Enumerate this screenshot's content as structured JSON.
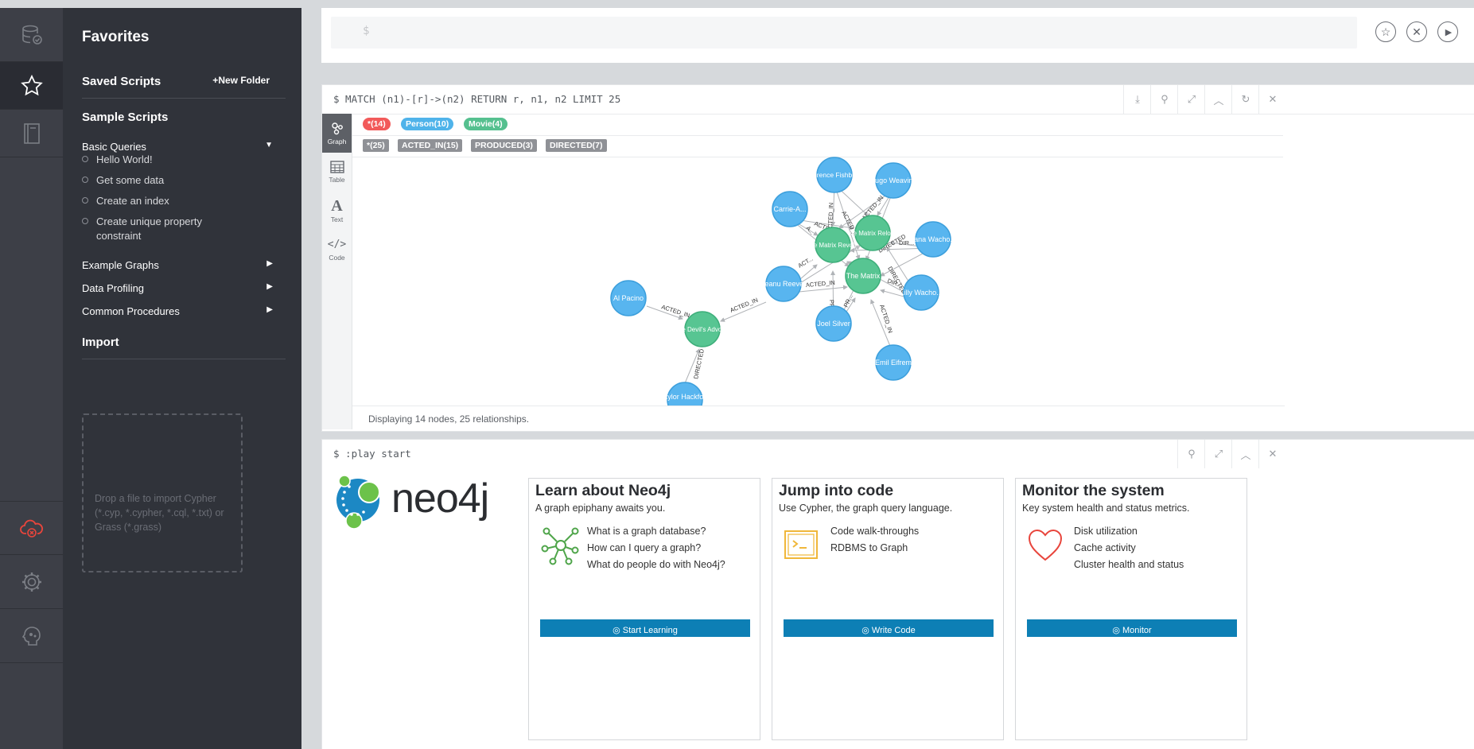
{
  "editor": {
    "prompt": "$"
  },
  "drawer": {
    "title": "Favorites",
    "saved_scripts": "Saved Scripts",
    "new_folder": "New Folder",
    "sample_scripts": "Sample Scripts",
    "basic_queries": "Basic Queries",
    "basic_items": [
      "Hello World!",
      "Get some data",
      "Create an index",
      "Create unique property constraint"
    ],
    "example_graphs": "Example Graphs",
    "data_profiling": "Data Profiling",
    "common_procedures": "Common Procedures",
    "import": "Import",
    "drop_text": "Drop a file to import Cypher (*.cyp, *.cypher, *.cql, *.txt) or Grass (*.grass)"
  },
  "result_frame": {
    "command": "$ MATCH (n1)-[r]->(n2) RETURN r, n1, n2 LIMIT 25",
    "tabs": [
      "Graph",
      "Table",
      "Text",
      "Code"
    ],
    "node_labels": [
      {
        "text": "*(14)",
        "color": "#f25a5a"
      },
      {
        "text": "Person(10)",
        "color": "#4fb3ea"
      },
      {
        "text": "Movie(4)",
        "color": "#55c08f"
      }
    ],
    "rel_types": [
      "*(25)",
      "ACTED_IN(15)",
      "PRODUCED(3)",
      "DIRECTED(7)"
    ],
    "status": "Displaying 14 nodes, 25 relationships.",
    "graph": {
      "person_nodes": [
        "Laurence Fishbur...",
        "Hugo Weaving",
        "Carrie-A...",
        "Lana Wacho...",
        "Keanu Reeves",
        "Lilly Wacho...",
        "Joel Silver",
        "Emil Eifrem",
        "Al Pacino",
        "Taylor Hackford"
      ],
      "movie_nodes": [
        "The Matrix Reloa...",
        "The Matrix Revol...",
        "The Matrix",
        "The Devil's Advoc..."
      ],
      "edge_labels": [
        "ACTED_IN",
        "DIRECTED",
        "PRODUCED",
        "ACT...",
        "DIR...",
        "PR...",
        "A..."
      ]
    }
  },
  "play_frame": {
    "command": "$ :play start",
    "logo_text": "neo4j",
    "cards": [
      {
        "title": "Learn about Neo4j",
        "desc": "A graph epiphany awaits you.",
        "items": [
          "What is a graph database?",
          "How can I query a graph?",
          "What do people do with Neo4j?"
        ],
        "button": "Start Learning"
      },
      {
        "title": "Jump into code",
        "desc": "Use Cypher, the graph query language.",
        "items": [
          "Code walk-throughs",
          "RDBMS to Graph"
        ],
        "button": "Write Code"
      },
      {
        "title": "Monitor the system",
        "desc": "Key system health and status metrics.",
        "items": [
          "Disk utilization",
          "Cache activity",
          "Cluster health and status"
        ],
        "button": "Monitor"
      }
    ]
  },
  "colors": {
    "person": "#58b5ef",
    "movie": "#57c592",
    "rail": "#3d3f47",
    "drawer": "#30333a",
    "button": "#0d7fb5",
    "alert": "#e8453c"
  }
}
